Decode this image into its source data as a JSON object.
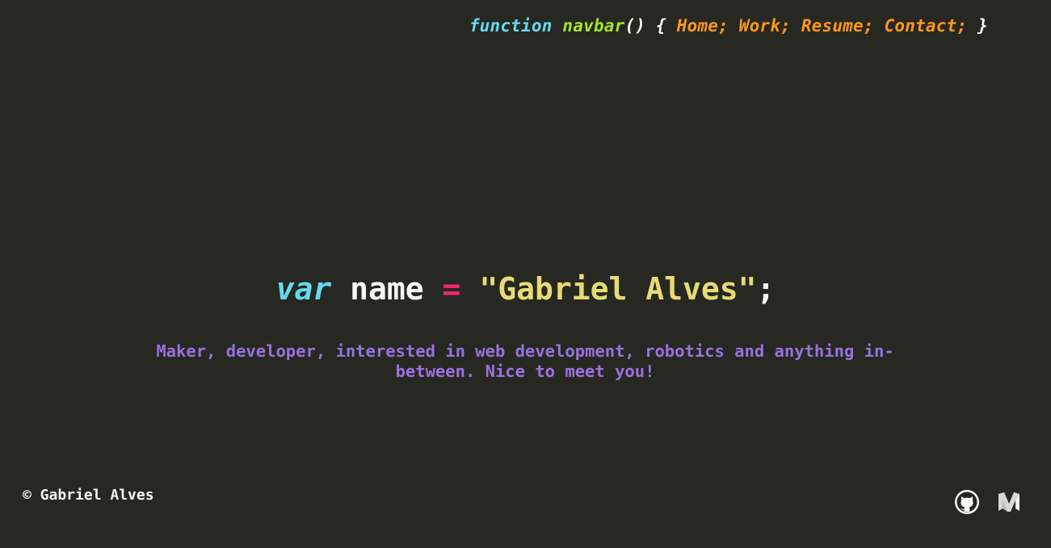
{
  "navbar": {
    "keyword": "function",
    "name": "navbar",
    "parens": "()",
    "open_brace": "{",
    "close_brace": "}",
    "links": [
      "Home;",
      "Work;",
      "Resume;",
      "Contact;"
    ]
  },
  "hero": {
    "keyword": "var",
    "identifier": "name",
    "operator": "=",
    "value": "\"Gabriel Alves\"",
    "terminator": ";"
  },
  "tagline": "Maker, developer, interested in web development, robotics and anything in-between. Nice to meet you!",
  "footer": {
    "copyright": "© Gabriel Alves",
    "social_icons": [
      "github-icon",
      "medium-icon"
    ]
  },
  "colors": {
    "background": "#272822",
    "keyword": "#66d9ef",
    "function_name": "#a6e22e",
    "link": "#fd971f",
    "operator": "#f92672",
    "string": "#e6db74",
    "tagline": "#9b71df",
    "text": "#f8f8f2"
  }
}
